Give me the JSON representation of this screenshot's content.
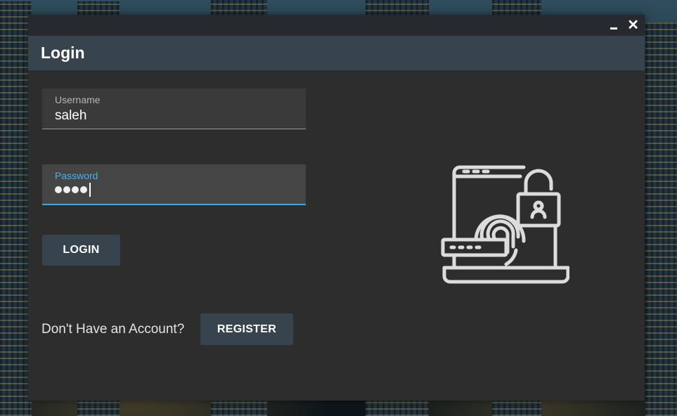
{
  "window": {
    "title": "Login",
    "minimize_icon": "minimize-icon",
    "close_icon": "close-icon"
  },
  "form": {
    "username": {
      "label": "Username",
      "value": "saleh"
    },
    "password": {
      "label": "Password",
      "masked_length": 4
    },
    "login_label": "LOGIN"
  },
  "footer": {
    "prompt": "Don't Have an Account?",
    "register_label": "REGISTER"
  },
  "illustration": {
    "icon": "fingerprint-laptop-lock-icon"
  },
  "colors": {
    "header_bg": "#37444d",
    "window_bg": "#2d2d2d",
    "focus_accent": "#3aa9df",
    "button_bg": "#37444d"
  }
}
